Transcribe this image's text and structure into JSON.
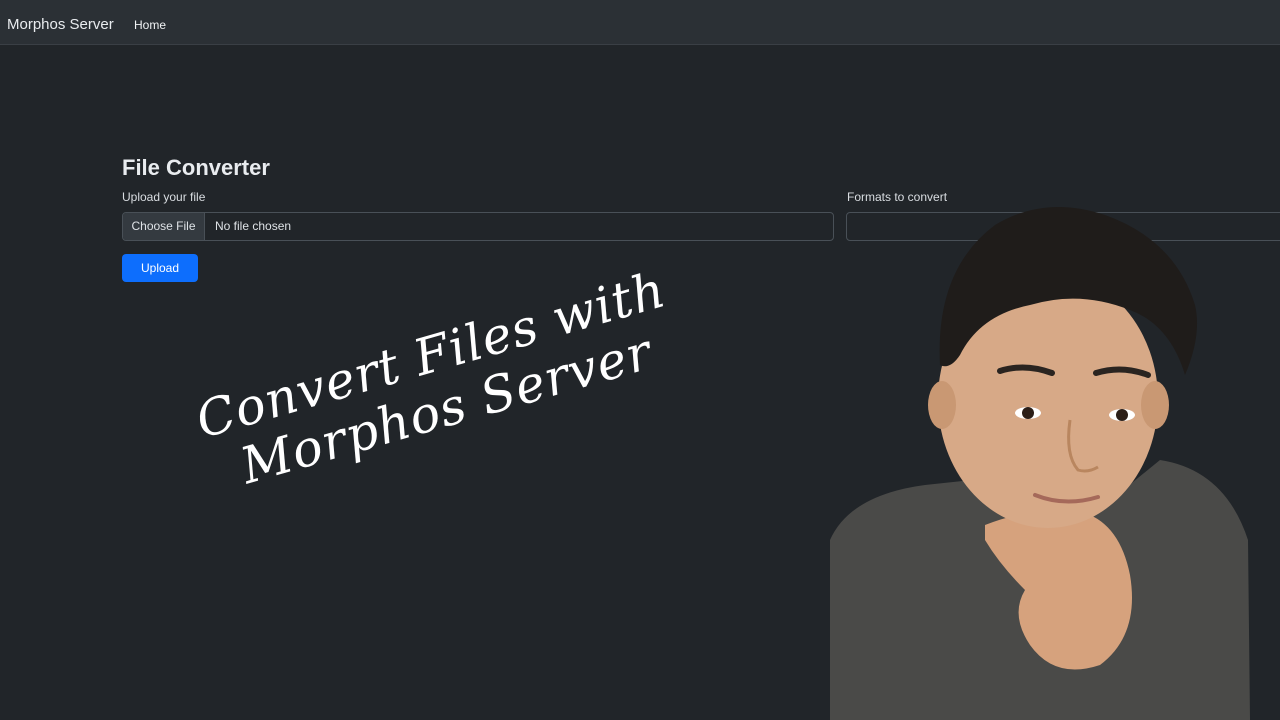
{
  "navbar": {
    "brand": "Morphos Server",
    "links": [
      "Home"
    ]
  },
  "converter": {
    "title": "File Converter",
    "upload_label": "Upload your file",
    "choose_file_label": "Choose File",
    "file_status": "No file chosen",
    "formats_label": "Formats to convert",
    "formats_value": "",
    "upload_button": "Upload"
  },
  "overlay": {
    "line1": "Convert Files with",
    "line2": "Morphos Server"
  },
  "colors": {
    "background": "#212529",
    "navbar": "#2b3035",
    "primary_button": "#0d6efd",
    "overlay_text": "#ffffff"
  }
}
